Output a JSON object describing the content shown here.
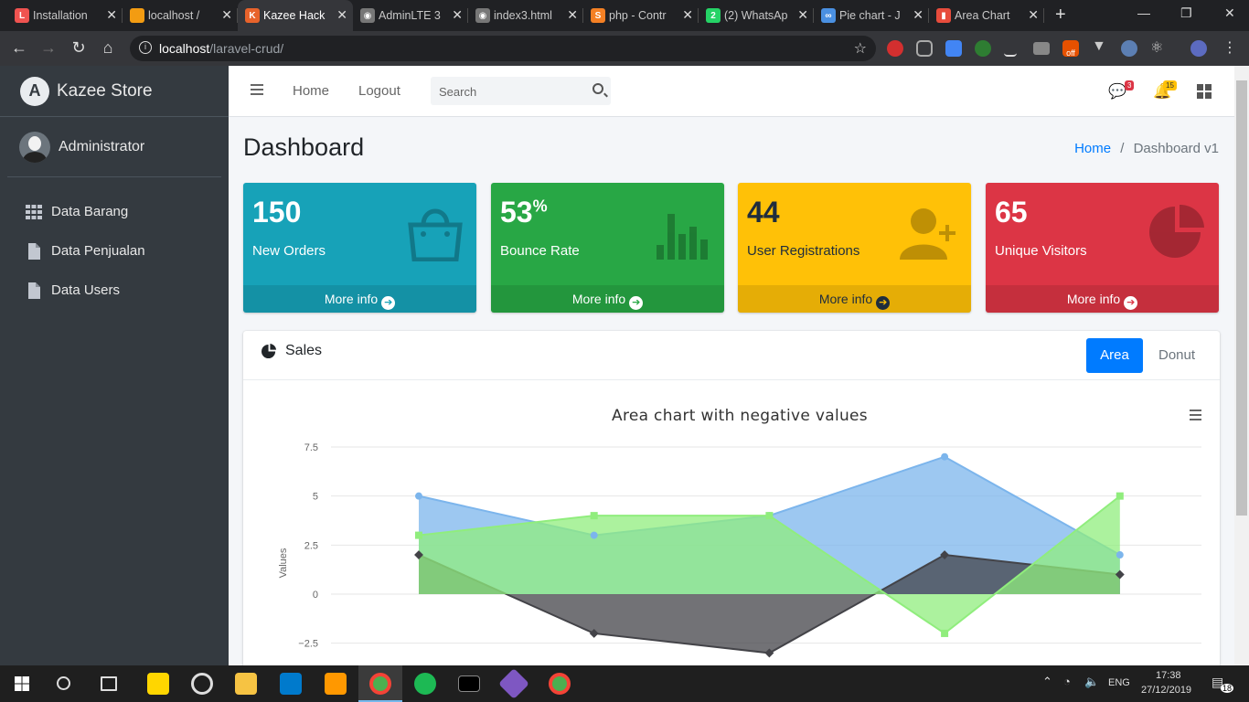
{
  "browser": {
    "tabs": [
      {
        "title": "Installation",
        "fav_color": "#ef5350",
        "fav_glyph": "L"
      },
      {
        "title": "localhost / ",
        "fav_color": "#f39c12",
        "fav_glyph": "pma"
      },
      {
        "title": "Kazee Hack",
        "fav_color": "#e8632b",
        "fav_glyph": "K"
      },
      {
        "title": "AdminLTE 3",
        "fav_color": "#777",
        "fav_glyph": "◉"
      },
      {
        "title": "index3.html",
        "fav_color": "#777",
        "fav_glyph": "◉"
      },
      {
        "title": "php - Contr",
        "fav_color": "#f48024",
        "fav_glyph": "S"
      },
      {
        "title": "(2) WhatsAp",
        "fav_color": "#25d366",
        "fav_glyph": "2"
      },
      {
        "title": "Pie chart - J",
        "fav_color": "#4a90e2",
        "fav_glyph": "∞"
      },
      {
        "title": "Area Chart ",
        "fav_color": "#e74c3c",
        "fav_glyph": "▮"
      }
    ],
    "active_tab": 2,
    "url_host": "localhost",
    "url_path": "/laravel-crud/",
    "off_label": "off"
  },
  "sidebar": {
    "brand": "Kazee Store",
    "brand_logo": "A",
    "user": "Administrator",
    "items": [
      {
        "label": "Data Barang",
        "icon": "grid-icon"
      },
      {
        "label": "Data Penjualan",
        "icon": "file-icon"
      },
      {
        "label": "Data Users",
        "icon": "file-icon"
      }
    ]
  },
  "topnav": {
    "home": "Home",
    "logout": "Logout",
    "search_placeholder": "Search",
    "messages_count": "3",
    "notifications_count": "15"
  },
  "header": {
    "title": "Dashboard",
    "crumb_home": "Home",
    "crumb_sep": "/",
    "crumb_current": "Dashboard v1"
  },
  "boxes": [
    {
      "value": "150",
      "suffix": "",
      "label": "New Orders",
      "color": "#17a2b8",
      "more": "More info",
      "icon": "shopping-bag-icon"
    },
    {
      "value": "53",
      "suffix": "%",
      "label": "Bounce Rate",
      "color": "#28a745",
      "more": "More info",
      "icon": "bar-chart-icon"
    },
    {
      "value": "44",
      "suffix": "",
      "label": "User Registrations",
      "color": "#ffc107",
      "more": "More info",
      "icon": "user-plus-icon"
    },
    {
      "value": "65",
      "suffix": "",
      "label": "Unique Visitors",
      "color": "#dc3545",
      "more": "More info",
      "icon": "pie-chart-icon"
    }
  ],
  "sales_card": {
    "title": "Sales",
    "tab_area": "Area",
    "tab_donut": "Donut"
  },
  "chart_data": {
    "type": "area",
    "title": "Area chart with negative values",
    "ylabel": "Values",
    "ylim": [
      -2.5,
      7.5
    ],
    "yticks": [
      7.5,
      5,
      2.5,
      0,
      -2.5
    ],
    "ytick_labels": [
      "7.5",
      "5",
      "2.5",
      "0",
      "−2.5"
    ],
    "x": [
      0,
      1,
      2,
      3,
      4
    ],
    "series": [
      {
        "values": [
          5,
          3,
          4,
          7,
          2
        ],
        "color": "#7cb5ec"
      },
      {
        "values": [
          2,
          -2,
          -3,
          2,
          1
        ],
        "color": "#434348"
      },
      {
        "values": [
          3,
          4,
          4,
          -2,
          5
        ],
        "color": "#90ed7d"
      }
    ]
  },
  "taskbar": {
    "time": "17:38",
    "date": "27/12/2019",
    "lang": "ENG",
    "notif_count": "18"
  }
}
